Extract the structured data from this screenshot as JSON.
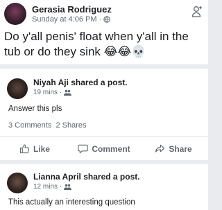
{
  "post": {
    "author": "Gerasia Rodriguez",
    "timestamp": "Sunday at 4:06 PM",
    "separator": "·",
    "text": "Do y'all penis' float when y'all in the tub or do they sink",
    "emojis": "😂😂💀"
  },
  "share1": {
    "sharer": "Niyah Aji shared a post.",
    "time": "19 mins",
    "separator": "·",
    "text": "Answer this pls",
    "comments": "3 Comments",
    "shares": "2 Shares"
  },
  "actions": {
    "like": "Like",
    "comment": "Comment",
    "share": "Share"
  },
  "share2": {
    "sharer": "Lianna April shared a post.",
    "time": "12 mins",
    "separator": "·",
    "text": "This actually an interesting question"
  },
  "colors": {
    "background": "#e9ebee",
    "card": "#ffffff",
    "secondary_text": "#606770"
  }
}
